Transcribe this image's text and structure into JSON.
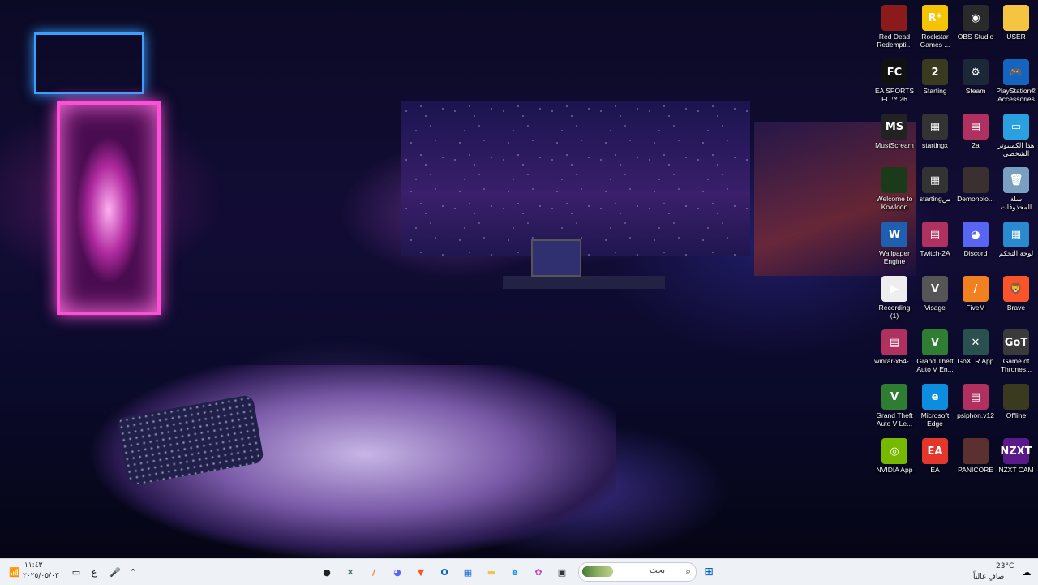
{
  "desktop": {
    "icons": [
      {
        "label": "Red Dead Redempti...",
        "glyph": "",
        "color": "#8b1a1a",
        "icon": "red-dead-icon"
      },
      {
        "label": "Rockstar Games ...",
        "glyph": "R*",
        "color": "#f6c300",
        "icon": "rockstar-icon"
      },
      {
        "label": "OBS Studio",
        "glyph": "◉",
        "color": "#2a2a2a",
        "icon": "obs-icon"
      },
      {
        "label": "USER",
        "glyph": "",
        "color": "#f5c542",
        "icon": "folder-icon"
      },
      {
        "label": "EA SPORTS FC™ 26",
        "glyph": "FC",
        "color": "#111111",
        "icon": "ea-fc-icon"
      },
      {
        "label": "Starting",
        "glyph": "2",
        "color": "#3a3a20",
        "icon": "starting-icon"
      },
      {
        "label": "Steam",
        "glyph": "⚙",
        "color": "#1b2838",
        "icon": "steam-icon"
      },
      {
        "label": "PlayStation® Accessories",
        "glyph": "🎮",
        "color": "#1565c0",
        "icon": "playstation-icon"
      },
      {
        "label": "MustScream",
        "glyph": "MS",
        "color": "#222222",
        "icon": "mustscream-icon"
      },
      {
        "label": "startingx",
        "glyph": "▦",
        "color": "#333333",
        "icon": "video-file-icon"
      },
      {
        "label": "2a",
        "glyph": "▤",
        "color": "#b03060",
        "icon": "winrar-icon"
      },
      {
        "label": "هذا الكمبيوتر الشخصي",
        "glyph": "▭",
        "color": "#2aa0e0",
        "icon": "this-pc-icon"
      },
      {
        "label": "Welcome to Kowloon",
        "glyph": "",
        "color": "#1a3a1a",
        "icon": "kowloon-icon"
      },
      {
        "label": "startingس",
        "glyph": "▦",
        "color": "#333333",
        "icon": "video-file-icon"
      },
      {
        "label": "Demonolo...",
        "glyph": "",
        "color": "#3a3030",
        "icon": "demonologist-icon"
      },
      {
        "label": "سلة المحذوفات",
        "glyph": "🗑",
        "color": "#7aa0c0",
        "icon": "recycle-bin-icon"
      },
      {
        "label": "Wallpaper Engine",
        "glyph": "W",
        "color": "#1e5fb0",
        "icon": "wallpaper-engine-icon"
      },
      {
        "label": "Twitch-2A",
        "glyph": "▤",
        "color": "#b03060",
        "icon": "winrar-icon"
      },
      {
        "label": "Discord",
        "glyph": "◕",
        "color": "#5865f2",
        "icon": "discord-icon"
      },
      {
        "label": "لوحة التحكم",
        "glyph": "▦",
        "color": "#2a8ad0",
        "icon": "control-panel-icon"
      },
      {
        "label": "Recording (1)",
        "glyph": "▶",
        "color": "#eeeeee",
        "icon": "video-file-icon"
      },
      {
        "label": "Visage",
        "glyph": "V",
        "color": "#555555",
        "icon": "visage-icon"
      },
      {
        "label": "FiveM",
        "glyph": "/",
        "color": "#f08020",
        "icon": "fivem-icon"
      },
      {
        "label": "Brave",
        "glyph": "🦁",
        "color": "#fb542b",
        "icon": "brave-icon"
      },
      {
        "label": "winrar-x64-...",
        "glyph": "▤",
        "color": "#b03060",
        "icon": "winrar-icon"
      },
      {
        "label": "Grand Theft Auto V En...",
        "glyph": "V",
        "color": "#2e7d32",
        "icon": "gta-icon"
      },
      {
        "label": "GoXLR App",
        "glyph": "✕",
        "color": "#2a5050",
        "icon": "goxlr-icon"
      },
      {
        "label": "Game of Thrones...",
        "glyph": "GoT",
        "color": "#3a3a3a",
        "icon": "got-icon"
      },
      {
        "label": "Grand Theft Auto V Le...",
        "glyph": "V",
        "color": "#2e7d32",
        "icon": "gta-icon"
      },
      {
        "label": "Microsoft Edge",
        "glyph": "e",
        "color": "#0c8de0",
        "icon": "edge-icon"
      },
      {
        "label": "psiphon.v12",
        "glyph": "▤",
        "color": "#b03060",
        "icon": "winrar-icon"
      },
      {
        "label": "Offline",
        "glyph": "",
        "color": "#3a3a20",
        "icon": "offline-icon"
      },
      {
        "label": "NVIDIA App",
        "glyph": "◎",
        "color": "#76b900",
        "icon": "nvidia-icon"
      },
      {
        "label": "EA",
        "glyph": "EA",
        "color": "#e5362b",
        "icon": "ea-icon"
      },
      {
        "label": "PANICORE",
        "glyph": "",
        "color": "#5a3030",
        "icon": "panicore-icon"
      },
      {
        "label": "NZXT CAM",
        "glyph": "NZXT",
        "color": "#5a1a8a",
        "icon": "nzxt-icon"
      }
    ]
  },
  "taskbar": {
    "search_placeholder": "بحث",
    "clock_time": "١١:٤٣",
    "clock_date": "٢٠٢٥/٠٥/٠٣",
    "weather_temp": "23°C",
    "weather_desc": "صافٍ غالباً",
    "lang": "ع",
    "apps": [
      {
        "name": "app-pinned-1",
        "glyph": "●",
        "color": "#222"
      },
      {
        "name": "app-terminal",
        "glyph": "✕",
        "color": "#1a5a3a"
      },
      {
        "name": "app-fivem",
        "glyph": "/",
        "color": "#f08020"
      },
      {
        "name": "app-discord",
        "glyph": "◕",
        "color": "#5865f2"
      },
      {
        "name": "app-brave",
        "glyph": "▼",
        "color": "#fb542b"
      },
      {
        "name": "app-outlook",
        "glyph": "O",
        "color": "#0a64c0"
      },
      {
        "name": "app-store",
        "glyph": "▦",
        "color": "#1a6ad0"
      },
      {
        "name": "app-explorer",
        "glyph": "▬",
        "color": "#f5c542"
      },
      {
        "name": "app-edge",
        "glyph": "e",
        "color": "#0c8de0"
      },
      {
        "name": "app-copilot",
        "glyph": "✿",
        "color": "#c040c0"
      },
      {
        "name": "app-taskview",
        "glyph": "▣",
        "color": "#333"
      }
    ]
  }
}
